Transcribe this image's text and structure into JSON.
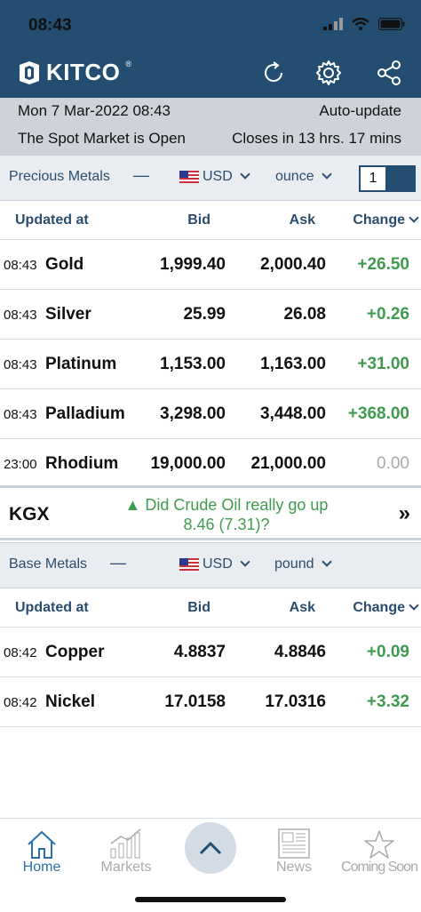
{
  "status": {
    "time": "08:43"
  },
  "header": {
    "logo": "KITCO",
    "reg": "®"
  },
  "info": {
    "date": "Mon 7 Mar-2022 08:43",
    "autoupdate": "Auto-update",
    "market_status": "The Spot Market is Open",
    "closes": "Closes in 13 hrs. 17 mins"
  },
  "precious": {
    "title": "Precious Metals",
    "dash": "—",
    "currency": "USD",
    "unit": "ounce",
    "quantity": "1",
    "columns": {
      "updated": "Updated at",
      "bid": "Bid",
      "ask": "Ask",
      "change": "Change"
    },
    "rows": [
      {
        "time": "08:43",
        "name": "Gold",
        "bid": "1,999.40",
        "ask": "2,000.40",
        "change": "+26.50"
      },
      {
        "time": "08:43",
        "name": "Silver",
        "bid": "25.99",
        "ask": "26.08",
        "change": "+0.26"
      },
      {
        "time": "08:43",
        "name": "Platinum",
        "bid": "1,153.00",
        "ask": "1,163.00",
        "change": "+31.00"
      },
      {
        "time": "08:43",
        "name": "Palladium",
        "bid": "3,298.00",
        "ask": "3,448.00",
        "change": "+368.00"
      },
      {
        "time": "23:00",
        "name": "Rhodium",
        "bid": "19,000.00",
        "ask": "21,000.00",
        "change": "0.00"
      }
    ]
  },
  "kgx": {
    "label": "KGX",
    "question_line1": "▲ Did Crude Oil really go up",
    "question_line2": "8.46 (7.31)?",
    "go": "»"
  },
  "base": {
    "title": "Base Metals",
    "dash": "—",
    "currency": "USD",
    "unit": "pound",
    "columns": {
      "updated": "Updated at",
      "bid": "Bid",
      "ask": "Ask",
      "change": "Change"
    },
    "rows": [
      {
        "time": "08:42",
        "name": "Copper",
        "bid": "4.8837",
        "ask": "4.8846",
        "change": "+0.09"
      },
      {
        "time": "08:42",
        "name": "Nickel",
        "bid": "17.0158",
        "ask": "17.0316",
        "change": "+3.32"
      }
    ]
  },
  "tabs": [
    {
      "label": "Home",
      "icon": "home-icon"
    },
    {
      "label": "Markets",
      "icon": "chart-icon"
    },
    {
      "label": "News",
      "icon": "newspaper-icon"
    },
    {
      "label": "Coming Soon",
      "icon": "star-icon"
    }
  ],
  "colors": {
    "header": "#234e72",
    "accent": "#2a6fb0",
    "positive": "#3f9b50"
  }
}
